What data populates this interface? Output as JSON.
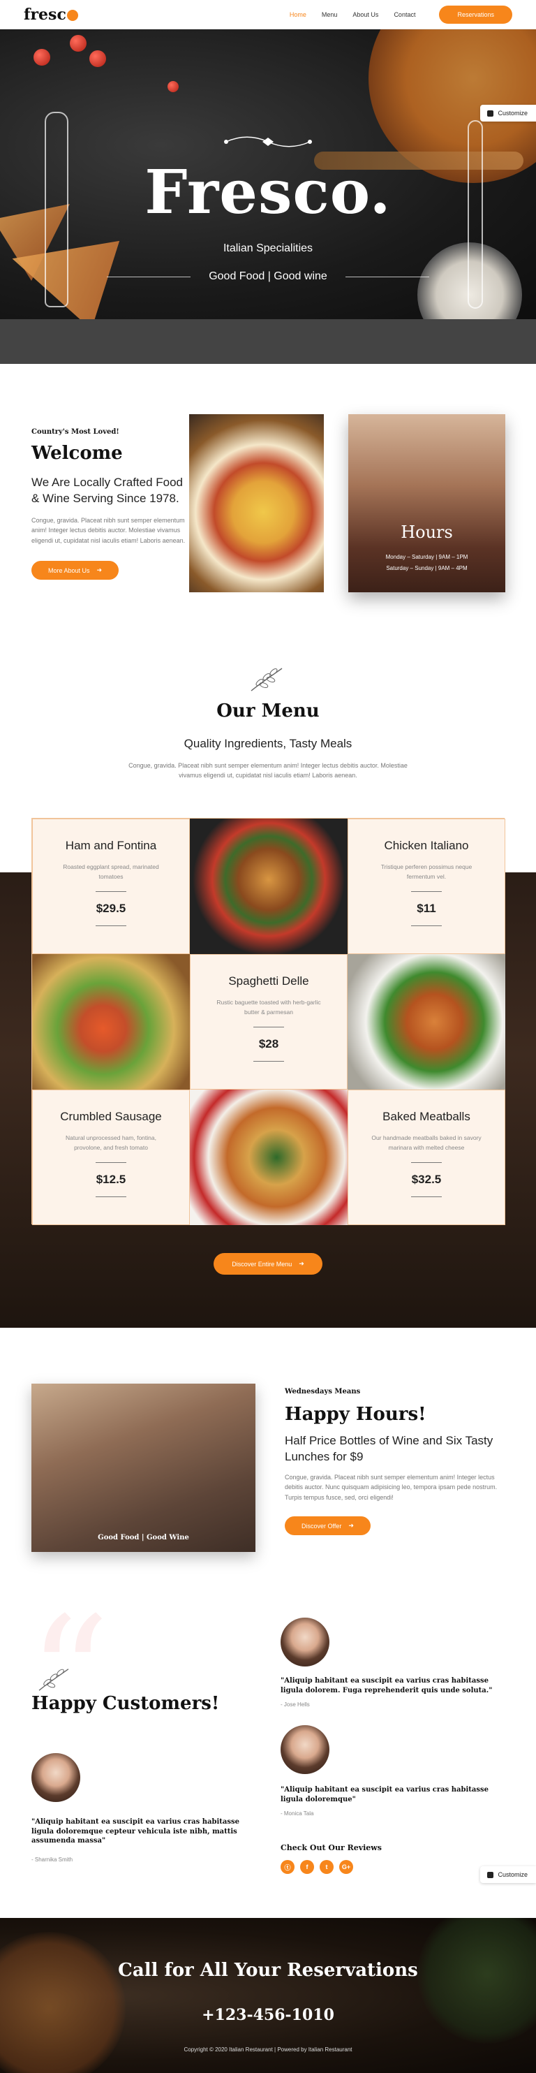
{
  "header": {
    "logo": "fresc",
    "nav": [
      "Home",
      "Menu",
      "About Us",
      "Contact"
    ],
    "reservation_label": "Reservations"
  },
  "customize_label": "Customize",
  "hero": {
    "title": "Fresco.",
    "subtitle": "Italian Specialities",
    "tagline": "Good Food | Good wine"
  },
  "welcome": {
    "kicker": "Country's Most Loved!",
    "title": "Welcome",
    "heading": "We Are Locally Crafted Food & Wine Serving Since 1978.",
    "body": "Congue, gravida. Placeat nibh sunt semper elementum anim! Integer lectus debitis auctor. Molestiae vivamus eligendi ut, cupidatat nisl iaculis etiam! Laboris aenean.",
    "button": "More About Us"
  },
  "hours": {
    "title": "Hours",
    "line1": "Monday – Saturday | 9AM – 1PM",
    "line2": "Saturday – Sunday | 9AM – 4PM"
  },
  "menu": {
    "title": "Our Menu",
    "subtitle": "Quality Ingredients, Tasty Meals",
    "body": "Congue, gravida. Placeat nibh sunt semper elementum anim! Integer lectus debitis auctor. Molestiae vivamus eligendi ut, cupidatat nisl iaculis etiam! Laboris aenean.",
    "items": [
      {
        "name": "Ham and Fontina",
        "desc": "Roasted eggplant spread, marinated tomatoes",
        "price": "$29.5"
      },
      {
        "name": "Chicken Italiano",
        "desc": "Tristique perferen possimus neque fermentum vel.",
        "price": "$11"
      },
      {
        "name": "Spaghetti Delle",
        "desc": "Rustic baguette toasted with herb-garlic butter & parmesan",
        "price": "$28"
      },
      {
        "name": "Crumbled Sausage",
        "desc": "Natural unprocessed ham, fontina, provolone, and fresh tomato",
        "price": "$12.5"
      },
      {
        "name": "Baked Meatballs",
        "desc": "Our handmade meatballs baked in savory marinara with melted cheese",
        "price": "$32.5"
      }
    ],
    "button": "Discover Entire Menu"
  },
  "happy_hours": {
    "photo_caption": "Good Food | Good Wine",
    "kicker": "Wednesdays Means",
    "title": "Happy Hours!",
    "heading": "Half Price Bottles of Wine and Six Tasty Lunches for $9",
    "body": "Congue, gravida. Placeat nibh sunt semper elementum anim! Integer lectus debitis auctor. Nunc quisquam adipisicing leo, tempora ipsam pede nostrum. Turpis tempus fusce, sed, orci eligendi!",
    "button": "Discover Offer"
  },
  "customers": {
    "title": "Happy Customers!",
    "testimonials": [
      {
        "quote": "\"Aliquip habitant ea suscipit ea varius cras habitasse ligula dolorem. Fuga reprehenderit quis unde soluta.\"",
        "name": "- Jose Hells"
      },
      {
        "quote": "\"Aliquip habitant ea suscipit ea varius cras habitasse ligula doloremque\"",
        "name": "- Monica Tala"
      },
      {
        "quote": "\"Aliquip habitant ea suscipit ea varius cras habitasse ligula doloremque cepteur vehicula iste nibh, mattis assumenda massa\"",
        "name": "- Sharnika Smith"
      }
    ],
    "reviews_label": "Check Out Our Reviews",
    "social_icons": [
      "tripadvisor-icon",
      "facebook-icon",
      "twitter-icon",
      "google-plus-icon"
    ],
    "social_glyphs": [
      "ⓣ",
      "f",
      "t",
      "G+"
    ]
  },
  "footer": {
    "title": "Call for All Your Reservations",
    "phone": "+123-456-1010",
    "copyright": "Copyright © 2020 Italian Restaurant | Powered by Italian Restaurant"
  },
  "colors": {
    "accent": "#f7861b",
    "cream": "#fdf3ea"
  }
}
